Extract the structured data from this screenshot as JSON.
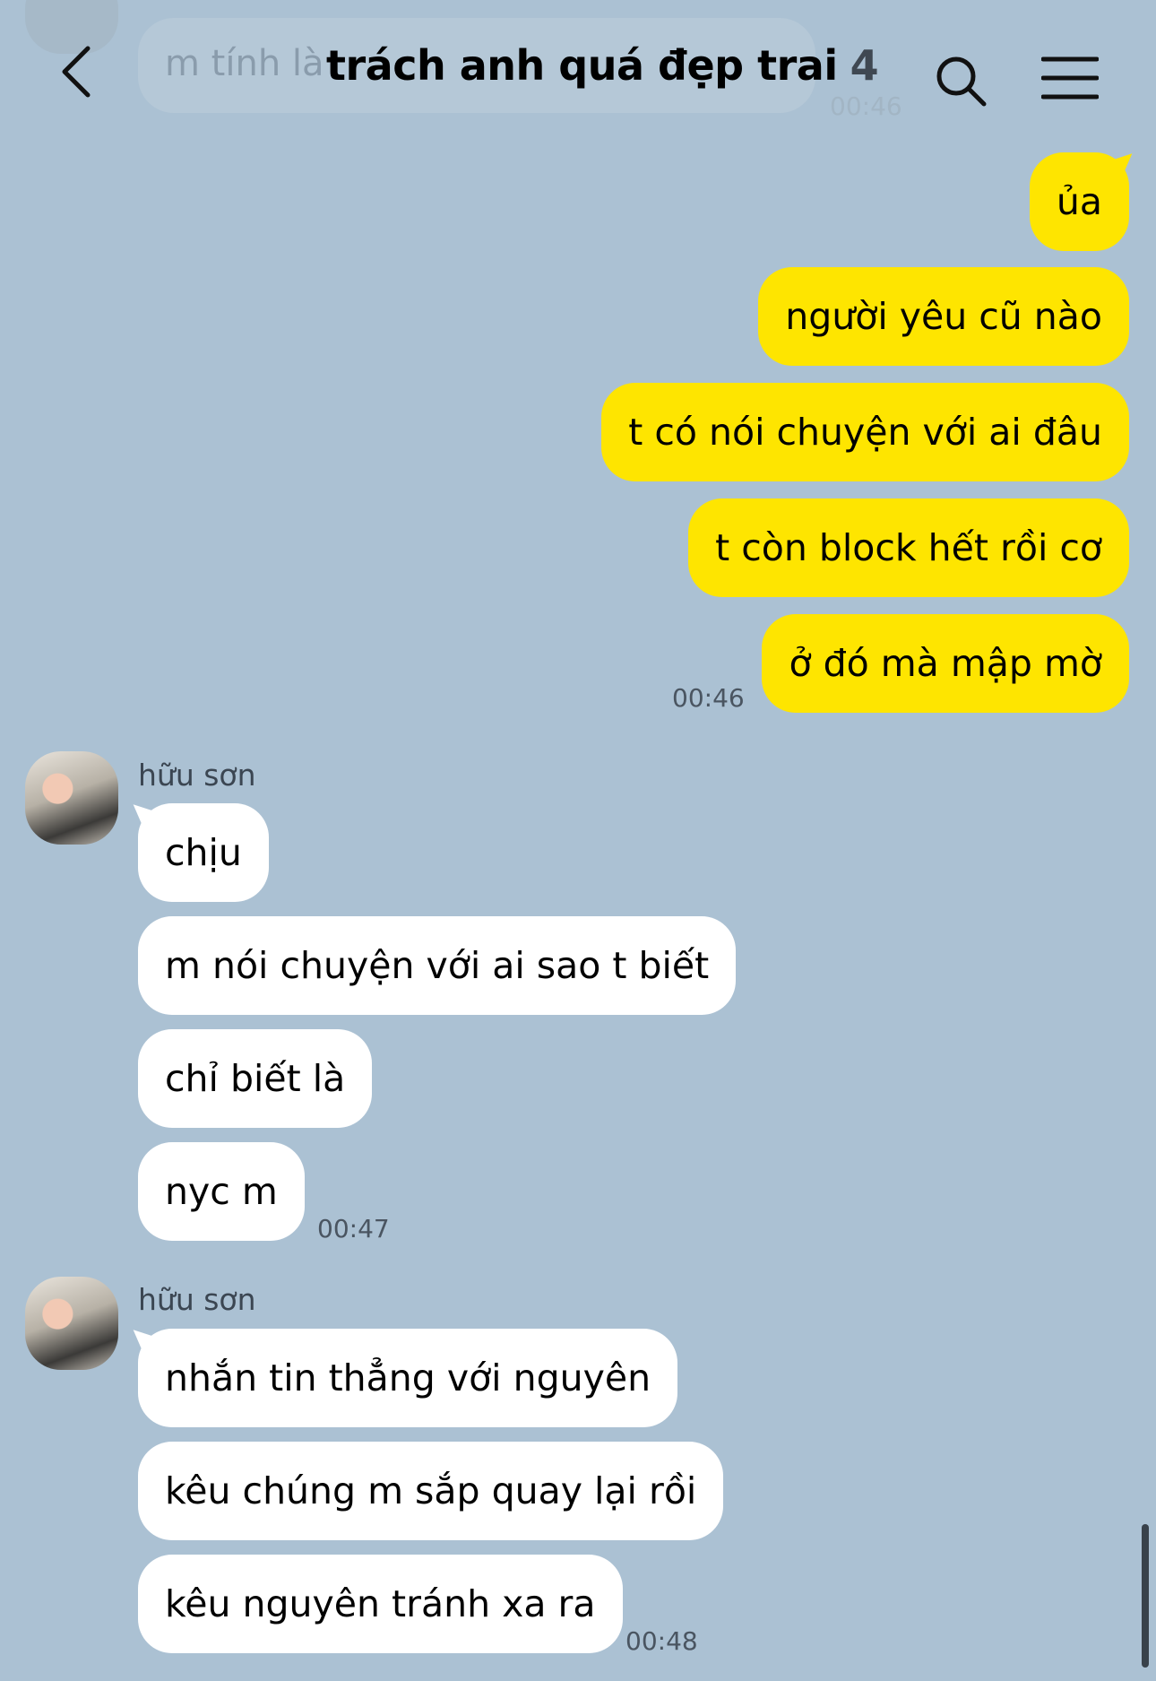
{
  "header": {
    "title": "trách anh quá đẹp trai",
    "member_count": "4"
  },
  "ghost": {
    "text": "m tính là",
    "time": "00:46"
  },
  "outgoing": {
    "messages": [
      "ủa",
      "người yêu cũ nào",
      "t có nói chuyện với ai đâu",
      "t còn block hết rồi cơ",
      "ở đó mà mập mờ"
    ],
    "time": "00:46"
  },
  "group1": {
    "sender": "hữu sơn",
    "messages": [
      "chịu",
      "m nói chuyện với ai sao t biết",
      "chỉ biết là",
      "nyc m"
    ],
    "time": "00:47"
  },
  "group2": {
    "sender": "hữu sơn",
    "messages": [
      "nhắn tin thẳng với nguyên",
      "kêu chúng m sắp quay lại rồi",
      "kêu nguyên tránh xa ra"
    ],
    "time": "00:48"
  },
  "colors": {
    "background": "#abc1d3",
    "outgoing_bubble": "#fee500",
    "incoming_bubble": "#ffffff"
  }
}
